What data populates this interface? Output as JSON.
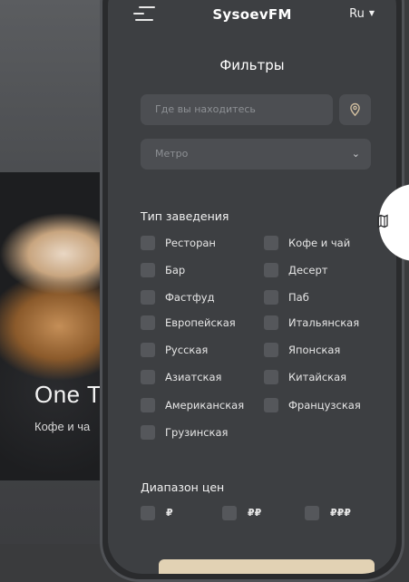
{
  "background_screen": {
    "title": "One T",
    "subtitle": "Кофе и ча"
  },
  "header": {
    "brand": "SysoevFM",
    "language": "Ru"
  },
  "filters": {
    "heading": "Фильтры",
    "location_placeholder": "Где вы находитесь",
    "metro_placeholder": "Метро"
  },
  "venue_type": {
    "title": "Тип заведения",
    "options": [
      "Ресторан",
      "Кофе и чай",
      "Бар",
      "Десерт",
      "Фастфуд",
      "Паб",
      "Европейская",
      "Итальянская",
      "Русская",
      "Японская",
      "Азиатская",
      "Китайская",
      "Американская",
      "Французская",
      "Грузинская"
    ]
  },
  "price_range": {
    "title": "Диапазон цен",
    "options": [
      "₽",
      "₽₽",
      "₽₽₽"
    ]
  },
  "colors": {
    "accent_button": "#e2d2b4",
    "screen_bg": "#3d3f42",
    "field_bg": "#4c4e52"
  }
}
